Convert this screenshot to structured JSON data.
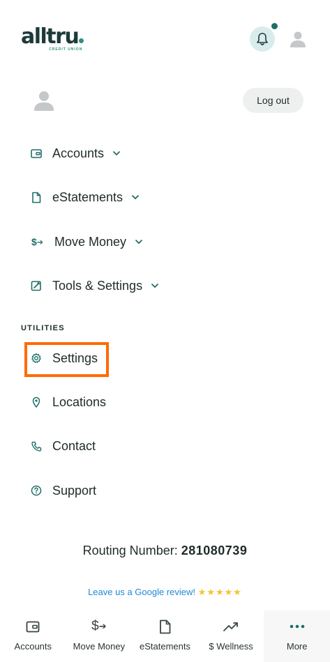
{
  "brand": {
    "name": "alltru",
    "tagline": "CREDIT UNION",
    "accent": "#1d6f66",
    "highlight_color": "#ff6a00"
  },
  "header": {
    "notifications_icon": "bell-icon",
    "profile_icon": "user-icon"
  },
  "profile": {
    "logout_label": "Log out"
  },
  "menu": {
    "items": [
      {
        "label": "Accounts",
        "icon": "wallet-icon"
      },
      {
        "label": "eStatements",
        "icon": "document-icon"
      },
      {
        "label": "Move Money",
        "icon": "transfer-icon"
      },
      {
        "label": "Tools & Settings",
        "icon": "tools-icon"
      }
    ]
  },
  "utilities": {
    "heading": "UTILITIES",
    "items": [
      {
        "label": "Settings",
        "icon": "gear-icon"
      },
      {
        "label": "Locations",
        "icon": "location-pin-icon"
      },
      {
        "label": "Contact",
        "icon": "phone-icon"
      },
      {
        "label": "Support",
        "icon": "help-icon"
      }
    ]
  },
  "routing": {
    "label": "Routing Number:",
    "number": "281080739"
  },
  "review": {
    "text": "Leave us a Google review!",
    "stars": "★★★★★"
  },
  "bottom_nav": [
    {
      "label": "Accounts",
      "icon": "wallet-icon"
    },
    {
      "label": "Move Money",
      "icon": "transfer-icon"
    },
    {
      "label": "eStatements",
      "icon": "document-icon"
    },
    {
      "label": "$ Wellness",
      "icon": "trend-icon"
    },
    {
      "label": "More",
      "icon": "more-icon"
    }
  ]
}
